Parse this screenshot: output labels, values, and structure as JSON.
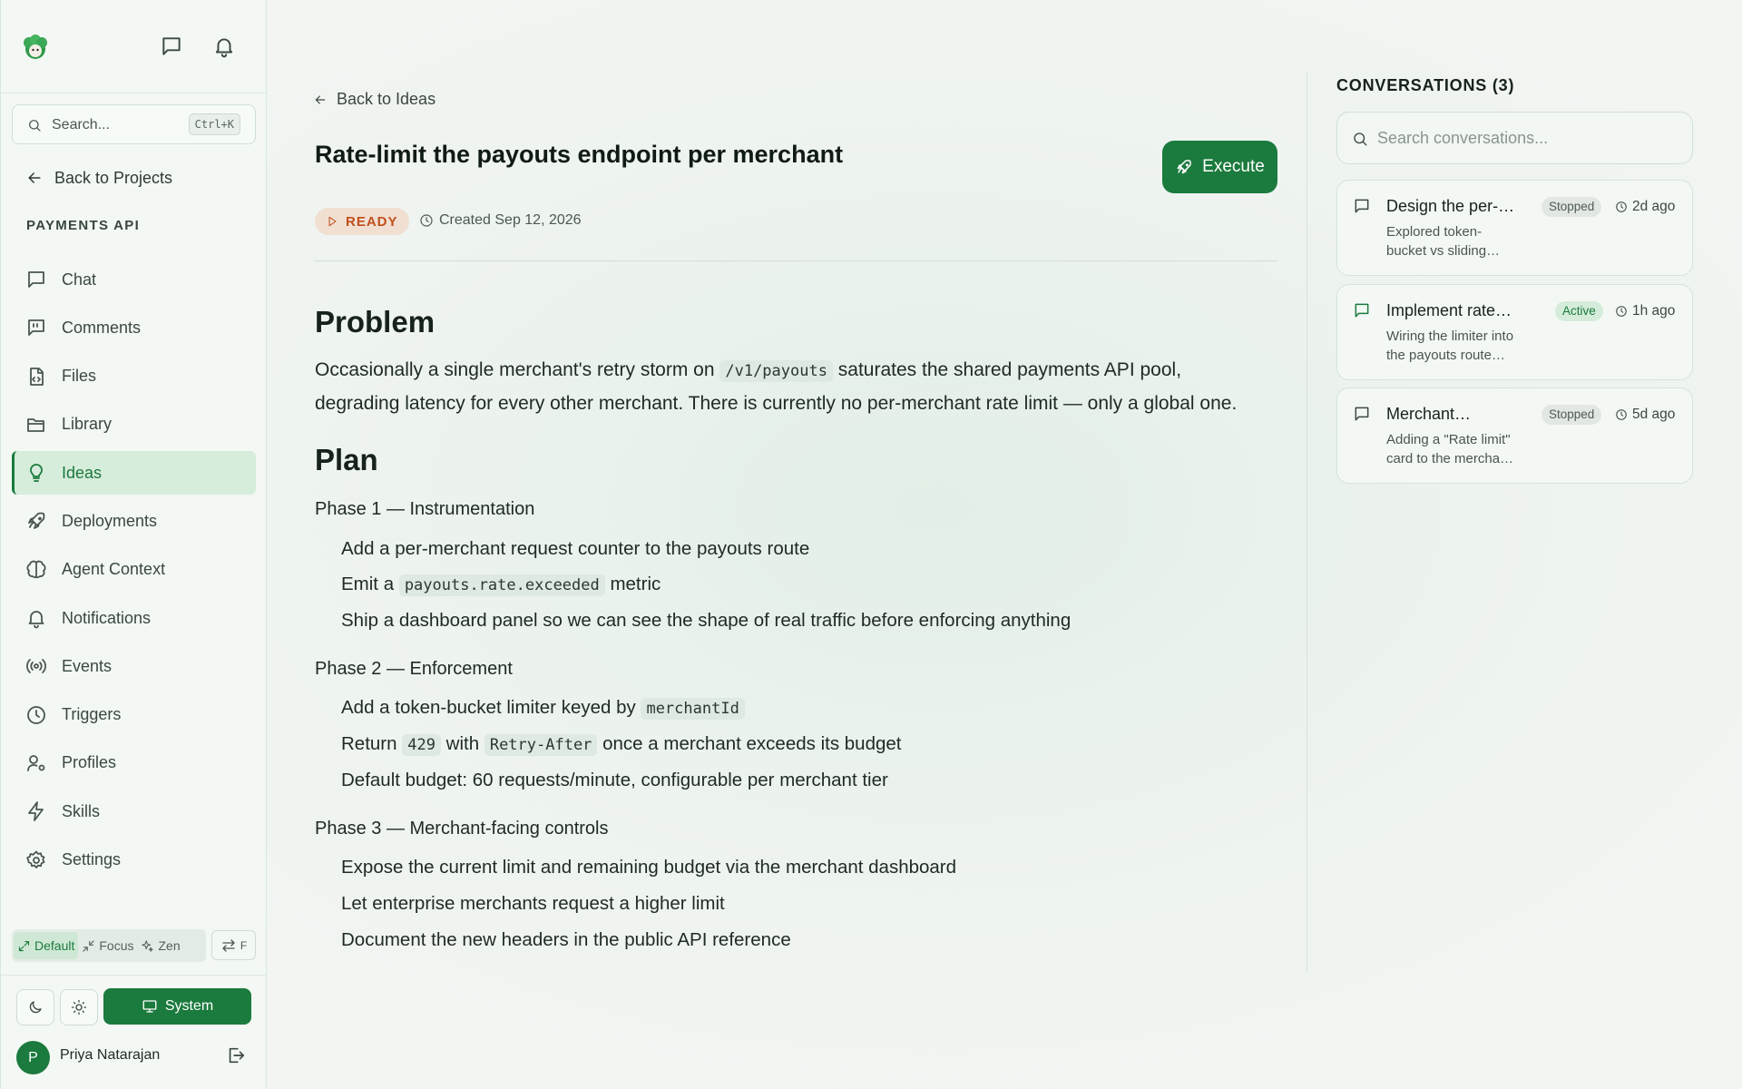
{
  "colors": {
    "accent": "#1b7a3d",
    "status_ready": "#c14f1c",
    "active_nav_bg": "#d6eddb"
  },
  "sidebar": {
    "search_placeholder": "Search...",
    "search_shortcut": "Ctrl+K",
    "back_label": "Back to Projects",
    "section_label": "PAYMENTS API",
    "items": [
      {
        "label": "Chat",
        "icon": "chat-icon"
      },
      {
        "label": "Comments",
        "icon": "comments-icon"
      },
      {
        "label": "Files",
        "icon": "file-icon"
      },
      {
        "label": "Library",
        "icon": "folder-icon"
      },
      {
        "label": "Ideas",
        "icon": "lightbulb-icon",
        "active": true
      },
      {
        "label": "Deployments",
        "icon": "rocket-icon"
      },
      {
        "label": "Agent Context",
        "icon": "brain-icon"
      },
      {
        "label": "Notifications",
        "icon": "bell-icon"
      },
      {
        "label": "Events",
        "icon": "broadcast-icon"
      },
      {
        "label": "Triggers",
        "icon": "clock-icon"
      },
      {
        "label": "Profiles",
        "icon": "user-cog-icon"
      },
      {
        "label": "Skills",
        "icon": "zap-icon"
      },
      {
        "label": "Settings",
        "icon": "gear-icon"
      }
    ],
    "modes": {
      "default": "Default",
      "focus": "Focus",
      "zen": "Zen",
      "swap_key": "F"
    },
    "theme_system": "System",
    "user": {
      "initial": "P",
      "name": "Priya Natarajan"
    }
  },
  "main": {
    "back_label": "Back to Ideas",
    "title": "Rate-limit the payouts endpoint per merchant",
    "execute_label": "Execute",
    "status": "READY",
    "created": "Created Sep 12, 2026",
    "problem_heading": "Problem",
    "problem_text": {
      "before": "Occasionally a single merchant's retry storm on",
      "code": "/v1/payouts",
      "after": "saturates the shared payments API pool,",
      "line2": "degrading latency for every other merchant. There is currently no per-merchant rate limit — only a global one."
    },
    "plan_heading": "Plan",
    "phase1": {
      "title": "Phase 1 — Instrumentation",
      "b1": "Add a per-merchant request counter to the payouts route",
      "b2_before": "Emit a",
      "b2_code": "payouts.rate.exceeded",
      "b2_after": "metric",
      "b3": "Ship a dashboard panel so we can see the shape of real traffic before enforcing anything"
    },
    "phase2": {
      "title": "Phase 2 — Enforcement",
      "b1_before": "Add a token-bucket limiter keyed by",
      "b1_code": "merchantId",
      "b2_before": "Return",
      "b2_code1": "429",
      "b2_mid": "with",
      "b2_code2": "Retry-After",
      "b2_after": "once a merchant exceeds its budget",
      "b3": "Default budget: 60 requests/minute, configurable per merchant tier"
    },
    "phase3": {
      "title": "Phase 3 — Merchant-facing controls",
      "b1": "Expose the current limit and remaining budget via the merchant dashboard",
      "b2": "Let enterprise merchants request a higher limit",
      "b3": "Document the new headers in the public API reference"
    }
  },
  "conversations": {
    "title": "CONVERSATIONS (3)",
    "search_placeholder": "Search conversations...",
    "items": [
      {
        "title": "Design the per-…",
        "desc1": "Explored token-",
        "desc2": "bucket vs sliding…",
        "status": "Stopped",
        "time": "2d ago"
      },
      {
        "title": "Implement rate…",
        "desc1": "Wiring the limiter into",
        "desc2": "the payouts route…",
        "status": "Active",
        "time": "1h ago"
      },
      {
        "title": "Merchant…",
        "desc1": "Adding a \"Rate limit\"",
        "desc2": "card to the mercha…",
        "status": "Stopped",
        "time": "5d ago"
      }
    ]
  }
}
